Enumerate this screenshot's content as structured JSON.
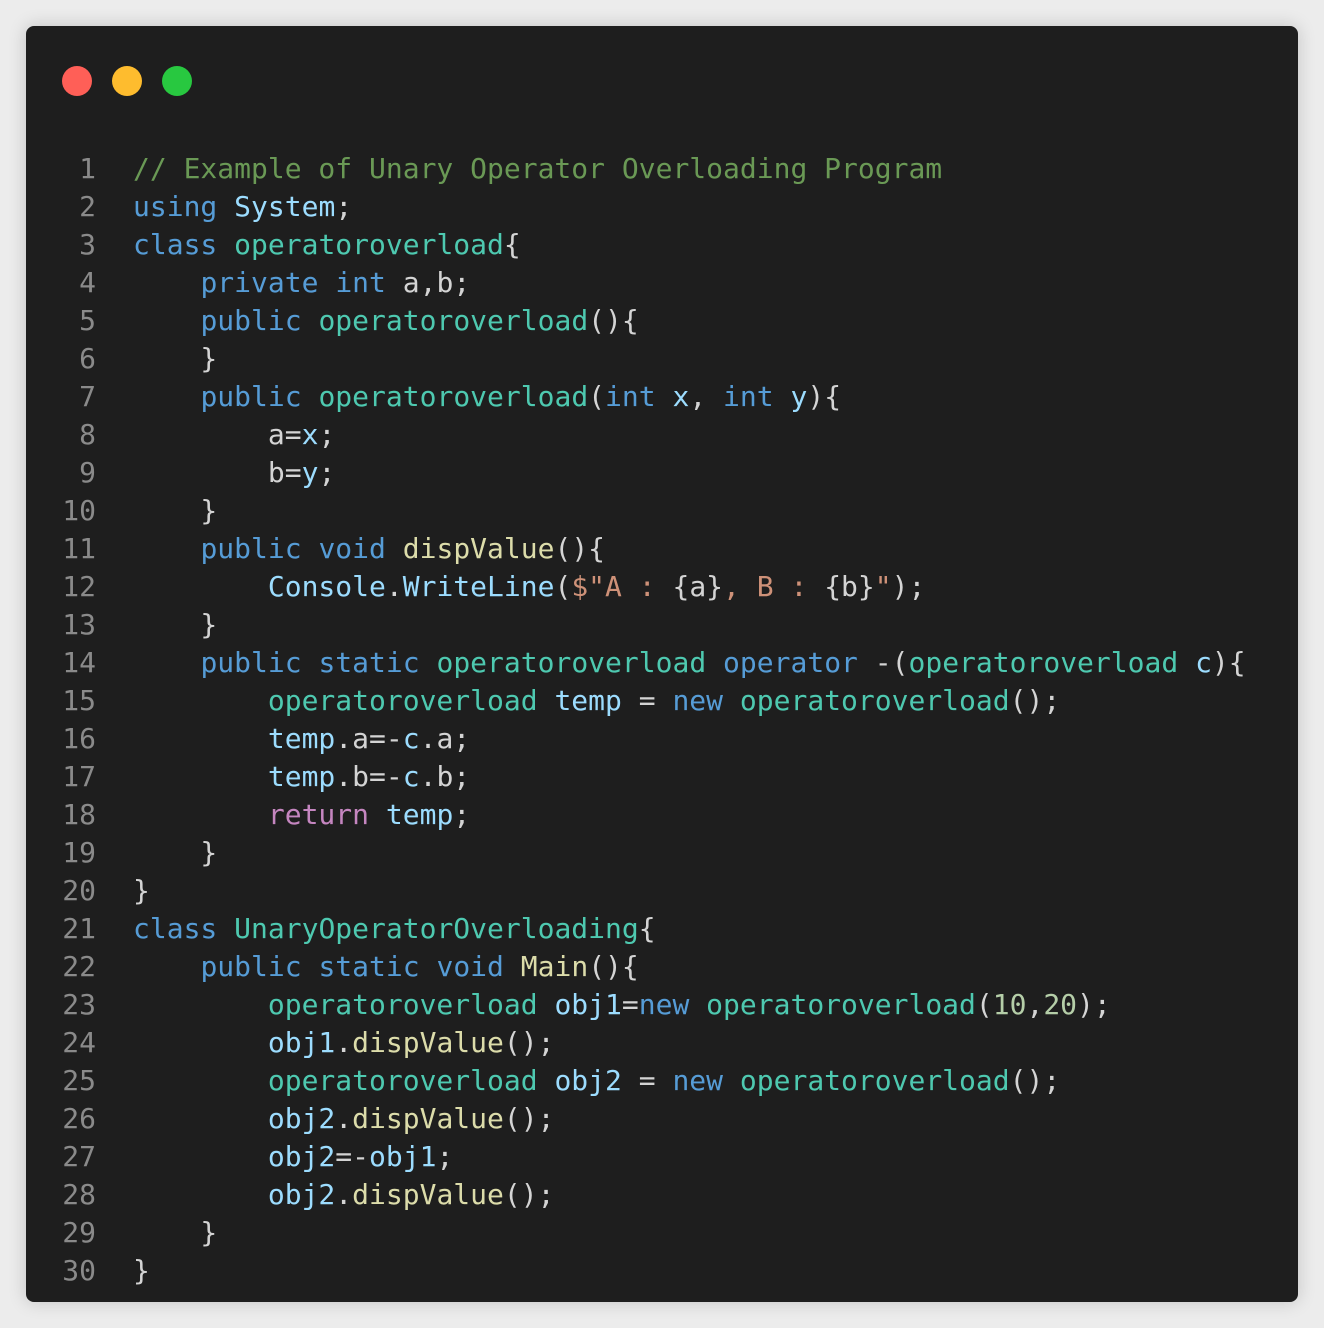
{
  "window": {
    "controls": [
      {
        "name": "close",
        "color": "#ff5f57"
      },
      {
        "name": "minimize",
        "color": "#febc2e"
      },
      {
        "name": "maximize",
        "color": "#28c840"
      }
    ]
  },
  "colors": {
    "comment": "#6a9955",
    "keyword": "#569cd6",
    "control": "#c586c0",
    "type": "#4ec9b0",
    "variable": "#9cdcfe",
    "function": "#dcdcaa",
    "string": "#ce9178",
    "number": "#b5cea8",
    "plain": "#d4d4d4"
  },
  "code": {
    "lines": [
      {
        "number": "1",
        "tokens": [
          [
            "// Example of Unary Operator Overloading Program",
            "comment"
          ]
        ]
      },
      {
        "number": "2",
        "tokens": [
          [
            "using",
            "keyword"
          ],
          [
            " ",
            "plain"
          ],
          [
            "System",
            "variable"
          ],
          [
            ";",
            "plain"
          ]
        ]
      },
      {
        "number": "3",
        "tokens": [
          [
            "class",
            "keyword"
          ],
          [
            " ",
            "plain"
          ],
          [
            "operatoroverload",
            "type"
          ],
          [
            "{",
            "plain"
          ]
        ]
      },
      {
        "number": "4",
        "tokens": [
          [
            "    ",
            "plain"
          ],
          [
            "private",
            "keyword"
          ],
          [
            " ",
            "plain"
          ],
          [
            "int",
            "keyword"
          ],
          [
            " a,b;",
            "plain"
          ]
        ]
      },
      {
        "number": "5",
        "tokens": [
          [
            "    ",
            "plain"
          ],
          [
            "public",
            "keyword"
          ],
          [
            " ",
            "plain"
          ],
          [
            "operatoroverload",
            "type"
          ],
          [
            "(){",
            "plain"
          ]
        ]
      },
      {
        "number": "6",
        "tokens": [
          [
            "    }",
            "plain"
          ]
        ]
      },
      {
        "number": "7",
        "tokens": [
          [
            "    ",
            "plain"
          ],
          [
            "public",
            "keyword"
          ],
          [
            " ",
            "plain"
          ],
          [
            "operatoroverload",
            "type"
          ],
          [
            "(",
            "plain"
          ],
          [
            "int",
            "keyword"
          ],
          [
            " ",
            "plain"
          ],
          [
            "x",
            "variable"
          ],
          [
            ", ",
            "plain"
          ],
          [
            "int",
            "keyword"
          ],
          [
            " ",
            "plain"
          ],
          [
            "y",
            "variable"
          ],
          [
            "){",
            "plain"
          ]
        ]
      },
      {
        "number": "8",
        "tokens": [
          [
            "        a=",
            "plain"
          ],
          [
            "x",
            "variable"
          ],
          [
            ";",
            "plain"
          ]
        ]
      },
      {
        "number": "9",
        "tokens": [
          [
            "        b=",
            "plain"
          ],
          [
            "y",
            "variable"
          ],
          [
            ";",
            "plain"
          ]
        ]
      },
      {
        "number": "10",
        "tokens": [
          [
            "    }",
            "plain"
          ]
        ]
      },
      {
        "number": "11",
        "tokens": [
          [
            "    ",
            "plain"
          ],
          [
            "public",
            "keyword"
          ],
          [
            " ",
            "plain"
          ],
          [
            "void",
            "keyword"
          ],
          [
            " ",
            "plain"
          ],
          [
            "dispValue",
            "function"
          ],
          [
            "(){",
            "plain"
          ]
        ]
      },
      {
        "number": "12",
        "tokens": [
          [
            "        ",
            "plain"
          ],
          [
            "Console",
            "variable"
          ],
          [
            ".",
            "plain"
          ],
          [
            "WriteLine",
            "variable"
          ],
          [
            "(",
            "plain"
          ],
          [
            "$\"A : ",
            "string"
          ],
          [
            "{a}",
            "plain"
          ],
          [
            ", B : ",
            "string"
          ],
          [
            "{b}",
            "plain"
          ],
          [
            "\"",
            "string"
          ],
          [
            ");",
            "plain"
          ]
        ]
      },
      {
        "number": "13",
        "tokens": [
          [
            "    }",
            "plain"
          ]
        ]
      },
      {
        "number": "14",
        "tokens": [
          [
            "    ",
            "plain"
          ],
          [
            "public",
            "keyword"
          ],
          [
            " ",
            "plain"
          ],
          [
            "static",
            "keyword"
          ],
          [
            " ",
            "plain"
          ],
          [
            "operatoroverload",
            "type"
          ],
          [
            " ",
            "plain"
          ],
          [
            "operator",
            "keyword"
          ],
          [
            " -(",
            "plain"
          ],
          [
            "operatoroverload",
            "type"
          ],
          [
            " ",
            "plain"
          ],
          [
            "c",
            "variable"
          ],
          [
            "){",
            "plain"
          ]
        ]
      },
      {
        "number": "15",
        "tokens": [
          [
            "        ",
            "plain"
          ],
          [
            "operatoroverload",
            "type"
          ],
          [
            " ",
            "plain"
          ],
          [
            "temp",
            "variable"
          ],
          [
            " = ",
            "plain"
          ],
          [
            "new",
            "keyword"
          ],
          [
            " ",
            "plain"
          ],
          [
            "operatoroverload",
            "type"
          ],
          [
            "();",
            "plain"
          ]
        ]
      },
      {
        "number": "16",
        "tokens": [
          [
            "        ",
            "plain"
          ],
          [
            "temp",
            "variable"
          ],
          [
            ".a=-",
            "plain"
          ],
          [
            "c",
            "variable"
          ],
          [
            ".a;",
            "plain"
          ]
        ]
      },
      {
        "number": "17",
        "tokens": [
          [
            "        ",
            "plain"
          ],
          [
            "temp",
            "variable"
          ],
          [
            ".b=-",
            "plain"
          ],
          [
            "c",
            "variable"
          ],
          [
            ".b;",
            "plain"
          ]
        ]
      },
      {
        "number": "18",
        "tokens": [
          [
            "        ",
            "plain"
          ],
          [
            "return",
            "control"
          ],
          [
            " ",
            "plain"
          ],
          [
            "temp",
            "variable"
          ],
          [
            ";",
            "plain"
          ]
        ]
      },
      {
        "number": "19",
        "tokens": [
          [
            "    }",
            "plain"
          ]
        ]
      },
      {
        "number": "20",
        "tokens": [
          [
            "}",
            "plain"
          ]
        ]
      },
      {
        "number": "21",
        "tokens": [
          [
            "class",
            "keyword"
          ],
          [
            " ",
            "plain"
          ],
          [
            "UnaryOperatorOverloading",
            "type"
          ],
          [
            "{",
            "plain"
          ]
        ]
      },
      {
        "number": "22",
        "tokens": [
          [
            "    ",
            "plain"
          ],
          [
            "public",
            "keyword"
          ],
          [
            " ",
            "plain"
          ],
          [
            "static",
            "keyword"
          ],
          [
            " ",
            "plain"
          ],
          [
            "void",
            "keyword"
          ],
          [
            " ",
            "plain"
          ],
          [
            "Main",
            "function"
          ],
          [
            "(){",
            "plain"
          ]
        ]
      },
      {
        "number": "23",
        "tokens": [
          [
            "        ",
            "plain"
          ],
          [
            "operatoroverload",
            "type"
          ],
          [
            " ",
            "plain"
          ],
          [
            "obj1",
            "variable"
          ],
          [
            "=",
            "plain"
          ],
          [
            "new",
            "keyword"
          ],
          [
            " ",
            "plain"
          ],
          [
            "operatoroverload",
            "type"
          ],
          [
            "(",
            "plain"
          ],
          [
            "10",
            "number"
          ],
          [
            ",",
            "plain"
          ],
          [
            "20",
            "number"
          ],
          [
            ");",
            "plain"
          ]
        ]
      },
      {
        "number": "24",
        "tokens": [
          [
            "        ",
            "plain"
          ],
          [
            "obj1",
            "variable"
          ],
          [
            ".",
            "plain"
          ],
          [
            "dispValue",
            "function"
          ],
          [
            "();",
            "plain"
          ]
        ]
      },
      {
        "number": "25",
        "tokens": [
          [
            "        ",
            "plain"
          ],
          [
            "operatoroverload",
            "type"
          ],
          [
            " ",
            "plain"
          ],
          [
            "obj2",
            "variable"
          ],
          [
            " = ",
            "plain"
          ],
          [
            "new",
            "keyword"
          ],
          [
            " ",
            "plain"
          ],
          [
            "operatoroverload",
            "type"
          ],
          [
            "();",
            "plain"
          ]
        ]
      },
      {
        "number": "26",
        "tokens": [
          [
            "        ",
            "plain"
          ],
          [
            "obj2",
            "variable"
          ],
          [
            ".",
            "plain"
          ],
          [
            "dispValue",
            "function"
          ],
          [
            "();",
            "plain"
          ]
        ]
      },
      {
        "number": "27",
        "tokens": [
          [
            "        ",
            "plain"
          ],
          [
            "obj2",
            "variable"
          ],
          [
            "=-",
            "plain"
          ],
          [
            "obj1",
            "variable"
          ],
          [
            ";",
            "plain"
          ]
        ]
      },
      {
        "number": "28",
        "tokens": [
          [
            "        ",
            "plain"
          ],
          [
            "obj2",
            "variable"
          ],
          [
            ".",
            "plain"
          ],
          [
            "dispValue",
            "function"
          ],
          [
            "();",
            "plain"
          ]
        ]
      },
      {
        "number": "29",
        "tokens": [
          [
            "    }",
            "plain"
          ]
        ]
      },
      {
        "number": "30",
        "tokens": [
          [
            "}",
            "plain"
          ]
        ]
      }
    ]
  }
}
